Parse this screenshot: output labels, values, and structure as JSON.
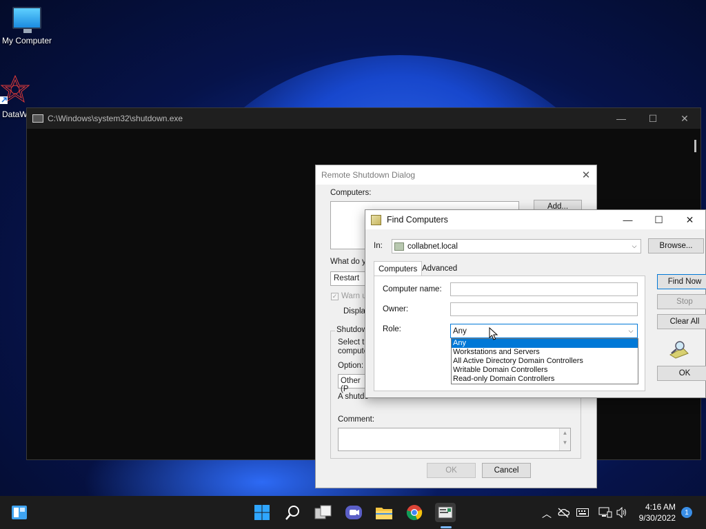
{
  "desktop": {
    "icons": [
      {
        "label": "My Computer"
      },
      {
        "label": "DataW"
      }
    ]
  },
  "console": {
    "title": "C:\\Windows\\system32\\shutdown.exe",
    "minimize": "—",
    "maximize": "☐",
    "close": "✕"
  },
  "shutdown_dialog": {
    "title": "Remote Shutdown Dialog",
    "close": "✕",
    "computers_label": "Computers:",
    "add_button": "Add...",
    "what_label": "What do yo",
    "action_value": "Restart",
    "warn_label": "Warn u",
    "display_label": "Displa",
    "group_label": "Shutdow",
    "select_text_1": "Select th",
    "select_text_2": "compute",
    "option_label": "Option:",
    "option_value": "Other (P",
    "shutdown_text": "A shutdo",
    "comment_label": "Comment:",
    "ok_button": "OK",
    "cancel_button": "Cancel"
  },
  "find_dialog": {
    "title": "Find Computers",
    "in_label": "In:",
    "in_value": "collabnet.local",
    "browse_button": "Browse...",
    "tabs": [
      {
        "label": "Computers"
      },
      {
        "label": "Advanced"
      }
    ],
    "computer_name_label": "Computer name:",
    "computer_name_value": "",
    "owner_label": "Owner:",
    "owner_value": "",
    "role_label": "Role:",
    "role_value": "Any",
    "role_options": [
      {
        "label": "Any"
      },
      {
        "label": "Workstations and Servers"
      },
      {
        "label": "All Active Directory Domain Controllers"
      },
      {
        "label": "Writable Domain Controllers"
      },
      {
        "label": "Read-only Domain Controllers"
      }
    ],
    "find_now_button": "Find Now",
    "stop_button": "Stop",
    "clear_all_button": "Clear All",
    "ok_button": "OK",
    "minimize": "—",
    "maximize": "☐",
    "close": "✕"
  },
  "taskbar": {
    "time": "4:16 AM",
    "date": "9/30/2022",
    "notification_count": "1"
  }
}
